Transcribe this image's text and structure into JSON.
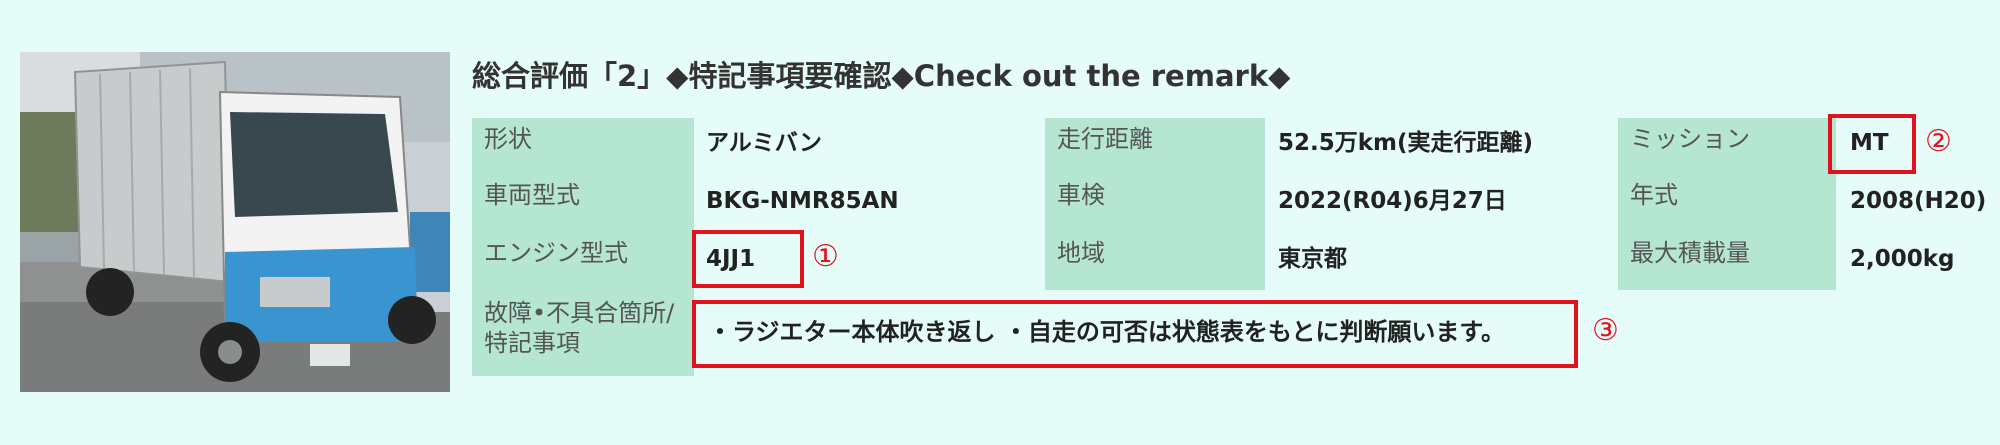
{
  "title": "総合評価「2」◆特記事項要確認◆Check out the remark◆",
  "specs": {
    "shape_label": "形状",
    "shape_value": "アルミバン",
    "mileage_label": "走行距離",
    "mileage_value": "52.5万km(実走行距離)",
    "mission_label": "ミッション",
    "mission_value": "MT",
    "model_label": "車両型式",
    "model_value": "BKG-NMR85AN",
    "inspection_label": "車検",
    "inspection_value": "2022(R04)6月27日",
    "year_label": "年式",
    "year_value": "2008(H20)",
    "engine_label": "エンジン型式",
    "engine_value": "4JJ1",
    "region_label": "地域",
    "region_value": "東京都",
    "payload_label": "最大積載量",
    "payload_value": "2,000kg",
    "defects_label_line1": "故障•不具合箇所/",
    "defects_label_line2": "特記事項",
    "defects_value": "・ラジエター本体吹き返し ・自走の可否は状態表をもとに判断願います。"
  },
  "markers": {
    "m1": "①",
    "m2": "②",
    "m3": "③"
  },
  "colors": {
    "background": "#e5fcf8",
    "label_bg": "#b5e6d2",
    "highlight": "#e0121e"
  }
}
